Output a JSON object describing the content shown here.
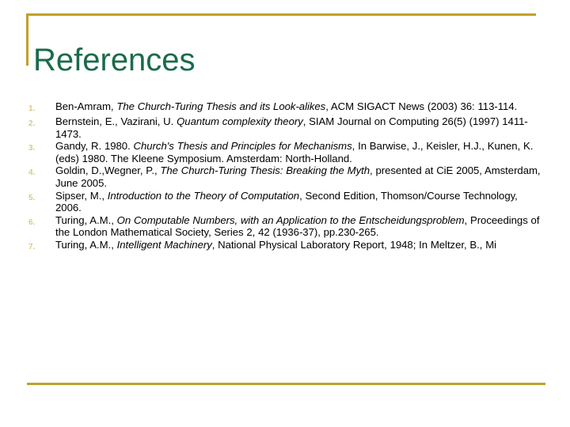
{
  "slide": {
    "title": "References",
    "colors": {
      "title_green": "#1a6b4a",
      "rule_gold": "#bfa12a",
      "number_gold": "#d8c887",
      "body_black": "#000000",
      "background": "#ffffff"
    }
  },
  "references": [
    {
      "number": "1.",
      "parts": [
        {
          "text": "Ben-Amram, ",
          "italic": false
        },
        {
          "text": "The Church-Turing Thesis and its Look-alikes",
          "italic": true
        },
        {
          "text": ", ACM SIGACT News (2003) 36: 113-114.",
          "italic": false
        }
      ],
      "plain": "Ben-Amram, The Church-Turing Thesis and its Look-alikes, ACM SIGACT News (2003) 36: 113-114."
    },
    {
      "number": "2.",
      "parts": [
        {
          "text": "Bernstein, E., Vazirani, U. ",
          "italic": false
        },
        {
          "text": "Quantum complexity theory",
          "italic": true
        },
        {
          "text": ", SIAM Journal on Computing 26(5) (1997) 1411-1473.",
          "italic": false
        }
      ],
      "plain": "Bernstein, E., Vazirani, U. Quantum complexity theory, SIAM Journal on Computing 26(5) (1997) 1411-1473."
    },
    {
      "number": "3.",
      "parts": [
        {
          "text": "Gandy, R. 1980. ",
          "italic": false
        },
        {
          "text": "Church's Thesis and Principles for Mechanisms",
          "italic": true
        },
        {
          "text": ", In Barwise, J., Keisler, H.J., Kunen, K. (eds) 1980. The Kleene Symposium. Amsterdam: North-Holland.",
          "italic": false
        }
      ],
      "plain": "Gandy, R. 1980. Church's Thesis and Principles for Mechanisms, In Barwise, J., Keisler, H.J., Kunen, K. (eds) 1980. The Kleene Symposium. Amsterdam: North-Holland."
    },
    {
      "number": "4.",
      "parts": [
        {
          "text": "Goldin, D.,Wegner, P., ",
          "italic": false
        },
        {
          "text": "The Church-Turing Thesis: Breaking the Myth",
          "italic": true
        },
        {
          "text": ", presented at CiE 2005, Amsterdam, June 2005.",
          "italic": false
        }
      ],
      "plain": "Goldin, D.,Wegner, P., The Church-Turing Thesis: Breaking the Myth, presented at CiE 2005, Amsterdam, June 2005."
    },
    {
      "number": "5.",
      "parts": [
        {
          "text": "Sipser, M., ",
          "italic": false
        },
        {
          "text": "Introduction to the Theory of Computation",
          "italic": true
        },
        {
          "text": ", Second Edition, Thomson/Course Technology, 2006.",
          "italic": false
        }
      ],
      "plain": "Sipser, M., Introduction to the Theory of Computation, Second Edition, Thomson/Course Technology, 2006."
    },
    {
      "number": "6.",
      "parts": [
        {
          "text": "Turing, A.M., ",
          "italic": false
        },
        {
          "text": "On Computable Numbers, with an Application to the Entscheidungsproblem",
          "italic": true
        },
        {
          "text": ", Proceedings of the London Mathematical Society, Series 2, 42 (1936-37), pp.230-265.",
          "italic": false
        }
      ],
      "plain": "Turing, A.M., On Computable Numbers, with an Application to the Entscheidungsproblem, Proceedings of the London Mathematical Society, Series 2, 42 (1936-37), pp.230-265."
    },
    {
      "number": "7.",
      "parts": [
        {
          "text": "Turing, A.M., ",
          "italic": false
        },
        {
          "text": "Intelligent Machinery",
          "italic": true
        },
        {
          "text": ", National Physical Laboratory Report, 1948; In Meltzer, B., Mi",
          "italic": false
        }
      ],
      "plain": "Turing, A.M., Intelligent Machinery, National Physical Laboratory Report, 1948; In Meltzer, B., Mi"
    }
  ]
}
